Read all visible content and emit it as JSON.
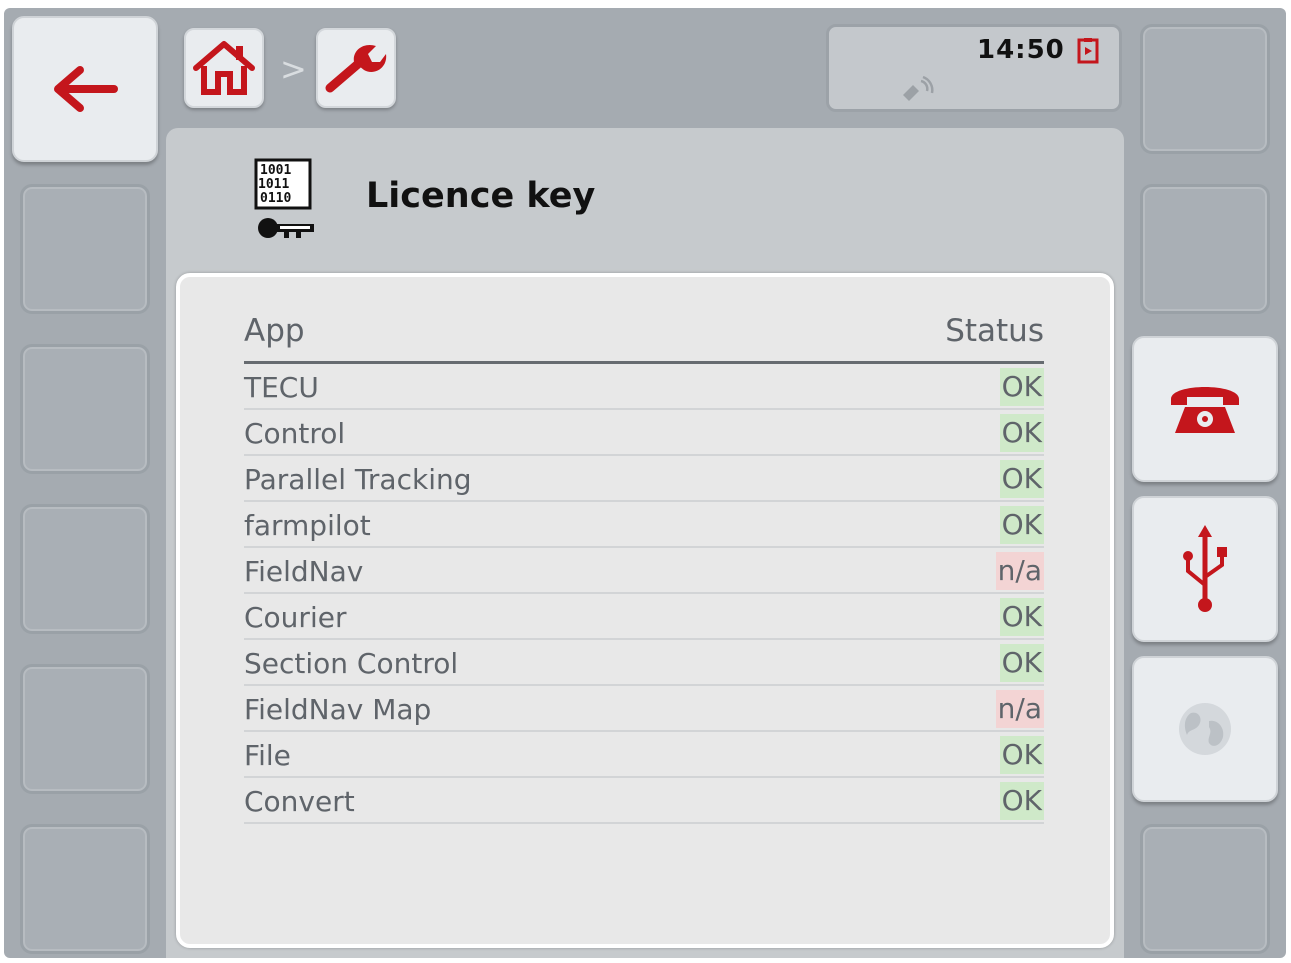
{
  "header": {
    "clock": "14:50",
    "breadcrumb_separator": ">"
  },
  "icons": {
    "back": "arrow-left-icon",
    "home": "home-icon",
    "settings": "wrench-icon",
    "title": "licence-key-icon",
    "phone": "phone-icon",
    "usb": "usb-icon",
    "web": "globe-icon",
    "gps": "gps-signal-icon",
    "recorder": "recorder-icon"
  },
  "page": {
    "title": "Licence key"
  },
  "table": {
    "columns": [
      "App",
      "Status"
    ],
    "rows": [
      {
        "app": "TECU",
        "status": "OK",
        "ok": true
      },
      {
        "app": "Control",
        "status": "OK",
        "ok": true
      },
      {
        "app": "Parallel Tracking",
        "status": "OK",
        "ok": true
      },
      {
        "app": "farmpilot",
        "status": "OK",
        "ok": true
      },
      {
        "app": "FieldNav",
        "status": "n/a",
        "ok": false
      },
      {
        "app": "Courier",
        "status": "OK",
        "ok": true
      },
      {
        "app": "Section Control",
        "status": "OK",
        "ok": true
      },
      {
        "app": "FieldNav Map",
        "status": "n/a",
        "ok": false
      },
      {
        "app": "File",
        "status": "OK",
        "ok": true
      },
      {
        "app": "Convert",
        "status": "OK",
        "ok": true
      }
    ]
  },
  "colors": {
    "accent": "#c4161c",
    "ok_bg": "#cfe9c9",
    "na_bg": "#f3d4d4"
  }
}
